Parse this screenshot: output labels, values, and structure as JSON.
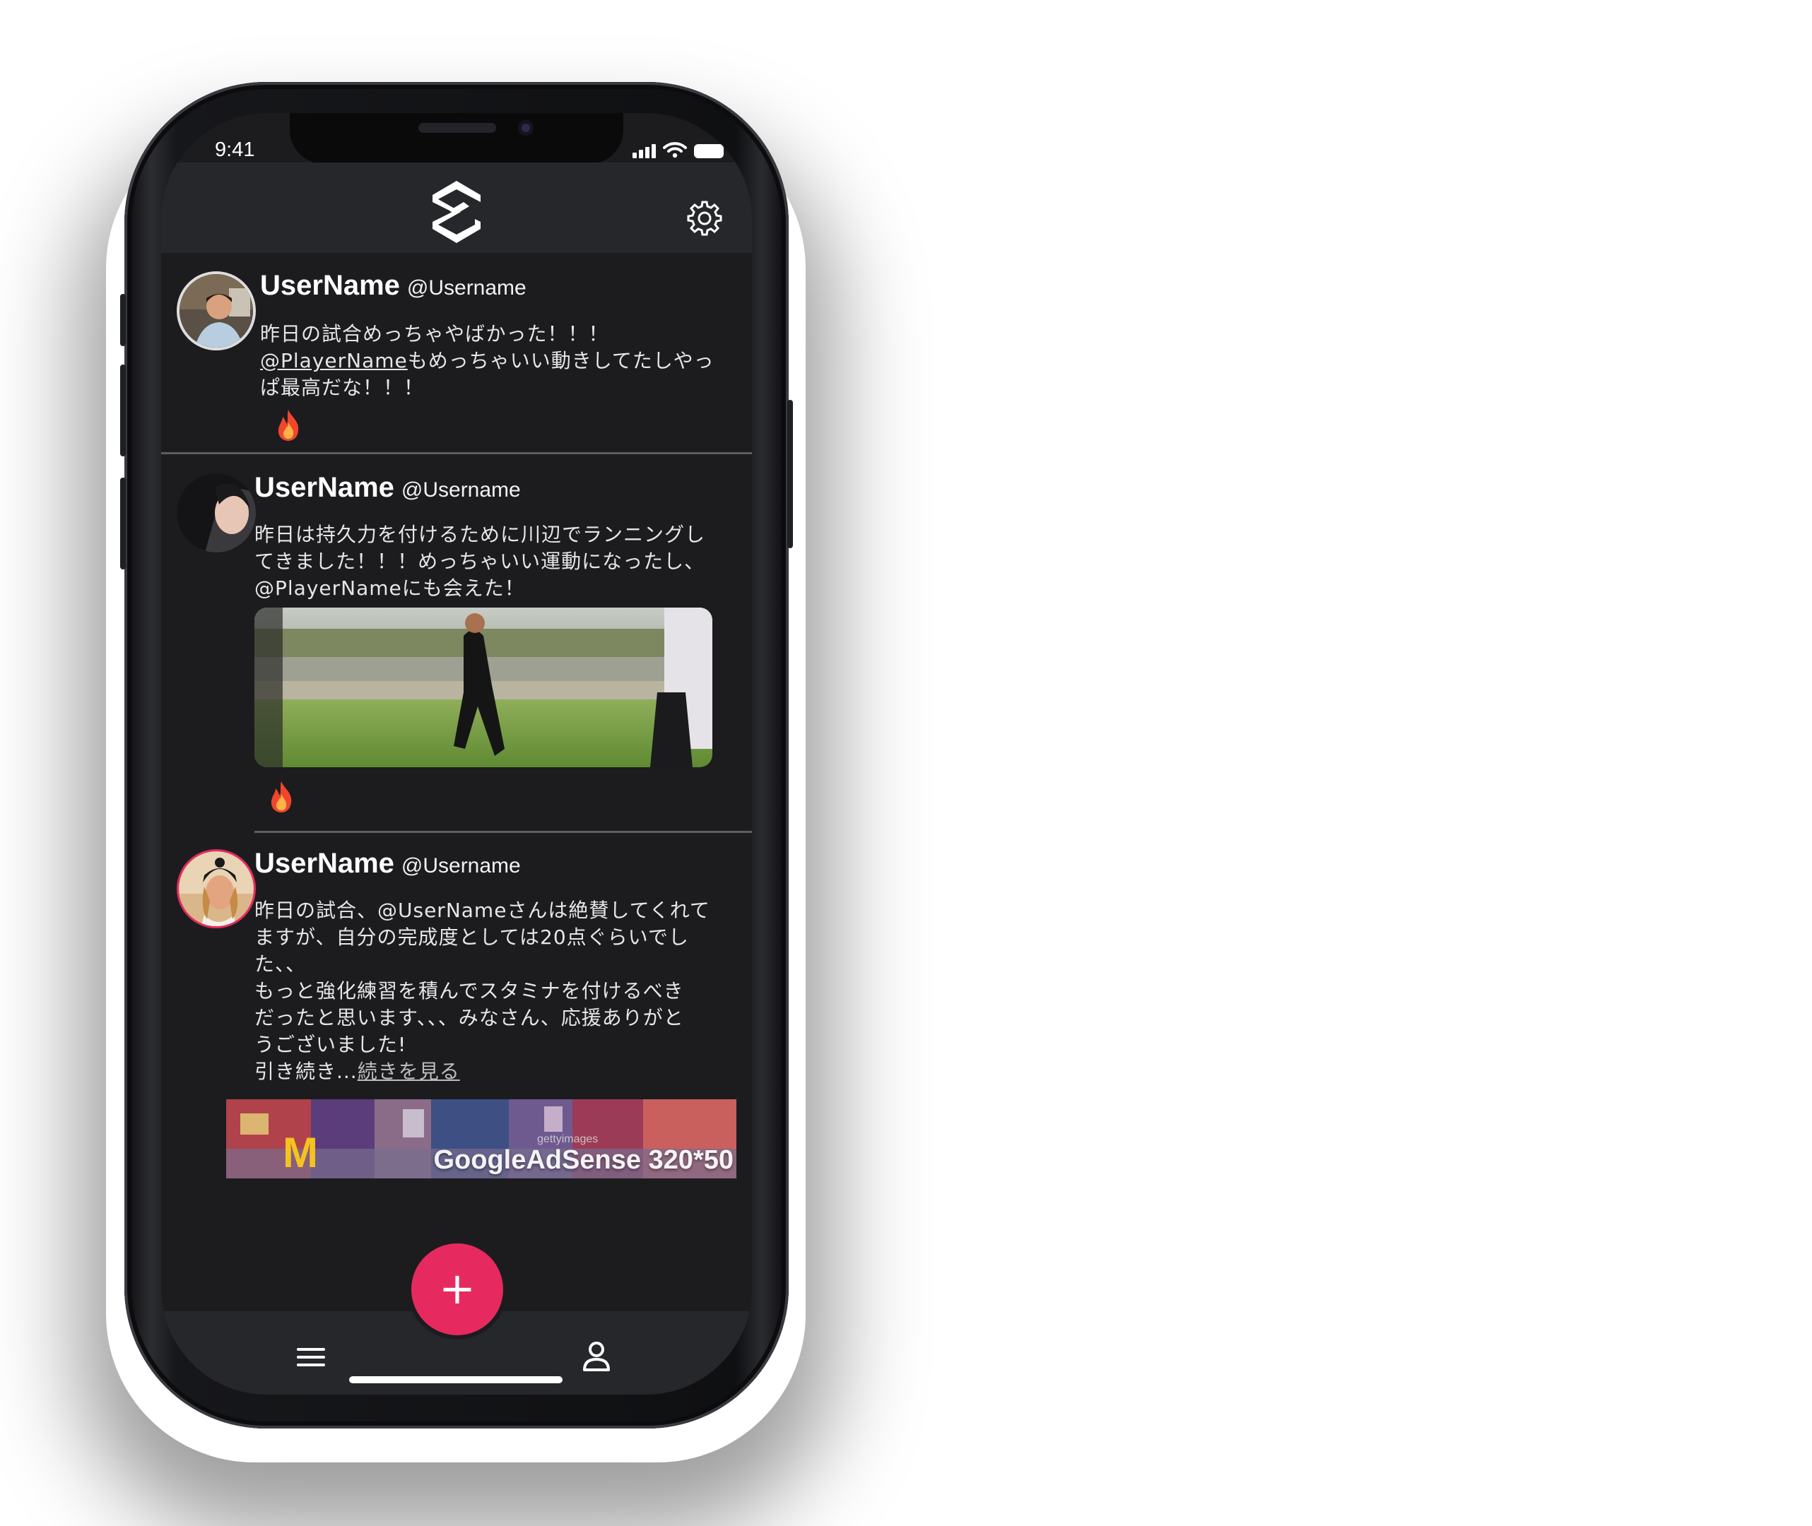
{
  "status_bar": {
    "time": "9:41"
  },
  "header": {
    "logo_icon": "app-logo-icon",
    "settings_icon": "gear-icon"
  },
  "posts": [
    {
      "display_name": "UserName",
      "handle": "@Username",
      "text_line1": "昨日の試合めっちゃやばかった！！！",
      "mention": "@PlayerName",
      "text_after_mention": "もめっちゃいい動きしてたしやっ\nぱ最高だな！！！",
      "reaction_icon": "fire-icon"
    },
    {
      "display_name": "UserName",
      "handle": "@Username",
      "text": "昨日は持久力を付けるために川辺でランニングし\nてきました！！！めっちゃいい運動になったし、\n@PlayerNameにも会えた！",
      "reaction_icon": "fire-icon"
    },
    {
      "display_name": "UserName",
      "handle": "@Username",
      "text": "昨日の試合、@UserNameさんは絶賛してくれて\nますが、自分の完成度としては20点ぐらいでし\nた、、\nもっと強化練習を積んでスタミナを付けるべき\nだったと思います、、、みなさん、応援ありがと\nうございました!\n引き続き...",
      "more_link": "続きを見る"
    }
  ],
  "ad": {
    "label": "GoogleAdSense 320*50",
    "watermark": "gettyimages"
  },
  "tab_bar": {
    "menu_icon": "menu-icon",
    "add_label": "+",
    "profile_icon": "profile-icon"
  },
  "colors": {
    "background": "#1c1c1f",
    "header": "#26272b",
    "accent": "#e62a5f"
  }
}
